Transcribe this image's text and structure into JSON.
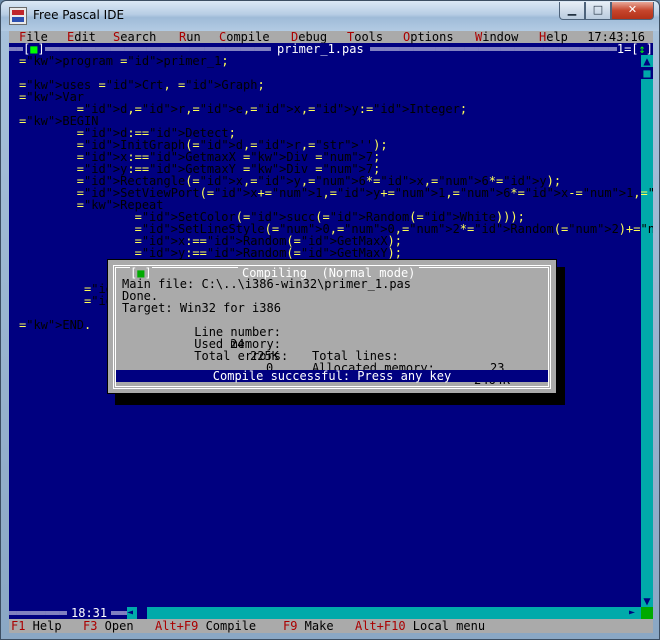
{
  "window": {
    "title": "Free Pascal IDE"
  },
  "menu": {
    "items": [
      {
        "hotkey": "F",
        "rest": "ile"
      },
      {
        "hotkey": "E",
        "rest": "dit"
      },
      {
        "hotkey": "S",
        "rest": "earch"
      },
      {
        "hotkey": "R",
        "rest": "un"
      },
      {
        "hotkey": "C",
        "rest": "ompile"
      },
      {
        "hotkey": "D",
        "rest": "ebug"
      },
      {
        "hotkey": "T",
        "rest": "ools"
      },
      {
        "hotkey": "O",
        "rest": "ptions"
      },
      {
        "hotkey": "W",
        "rest": "indow"
      },
      {
        "hotkey": "H",
        "rest": "elp"
      }
    ],
    "clock": "17:43:16"
  },
  "editor": {
    "filename": "primer_1.pas",
    "window_number": "1",
    "cursor_pos": "18:31",
    "lines": [
      "program primer_1;",
      "",
      "uses Crt, Graph;",
      "Var",
      "        d,r,e,x,y:Integer;",
      "BEGIN",
      "        d:=Detect;",
      "        InitGraph(d,r,'');",
      "        x:=GetmaxX Div 7;",
      "        y:=GetmaxY Div 7;",
      "        Rectangle(x,y,6*x,6*y);",
      "        SetViewPort(x+1,y+1,6*x-1,6*y-1,ClipOn);",
      "        Repeat",
      "                SetColor(succ(Random(White)));",
      "                SetLineStyle(0,0,2*Random(2)+1);",
      "                x:=Random(GetMaxX);",
      "                y:=Random(GetMaxY);",
      "",
      "",
      "         Un",
      "         Cl",
      "",
      "END."
    ]
  },
  "dialog": {
    "title": "Compiling  (Normal mode)",
    "main_file_label": "Main file:",
    "main_file": "C:\\..\\i386-win32\\primer_1.pas",
    "done": "Done.",
    "target_label": "Target:",
    "target": "Win32 for i386",
    "line_number_label": "Line number:",
    "line_number": "24",
    "total_lines_label": "Total lines:",
    "total_lines": "23",
    "used_memory_label": "Used memory:",
    "used_memory": "225K",
    "allocated_memory_label": "Allocated memory:",
    "allocated_memory": "2464K",
    "total_errors_label": "Total errors:",
    "total_errors": "0",
    "status": "Compile successful: Press any key"
  },
  "statusbar": [
    {
      "key": "F1",
      "label": "Help"
    },
    {
      "key": "F3",
      "label": "Open"
    },
    {
      "key": "Alt+F9",
      "label": "Compile"
    },
    {
      "key": "F9",
      "label": "Make"
    },
    {
      "key": "Alt+F10",
      "label": "Local menu"
    }
  ],
  "colors": {
    "background": "#000080",
    "text": "#ffff55",
    "keyword": "#ffffff",
    "number": "#00aaaa",
    "menu": "#aaaaaa",
    "hotkey": "#aa0000"
  }
}
